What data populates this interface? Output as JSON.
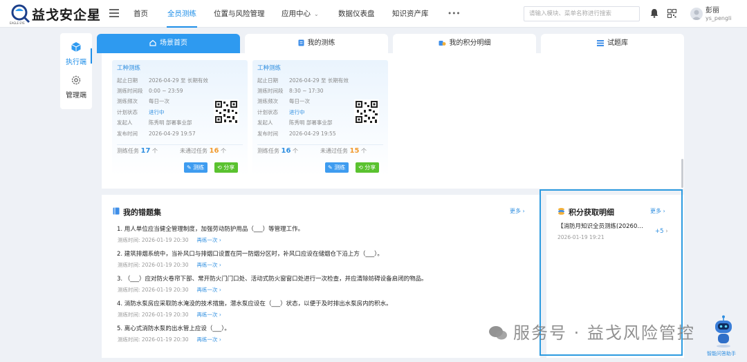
{
  "brand": {
    "name": "益戈安企星",
    "logo_caption": "EAGLE EYE"
  },
  "nav": {
    "items": [
      "首页",
      "全员测练",
      "位置与风险管理",
      "应用中心",
      "数据仪表盘",
      "知识资产库",
      "•••"
    ],
    "active": "全员测练"
  },
  "search": {
    "placeholder": "请输入模块、菜单名称进行搜索"
  },
  "user": {
    "name": "彭丽",
    "id": "ys_pengli"
  },
  "sidebar": {
    "items": [
      {
        "label": "执行端",
        "icon": "cube-icon"
      },
      {
        "label": "管理端",
        "icon": "gear-icon"
      }
    ]
  },
  "tabs": [
    {
      "label": "场景首页",
      "icon": "home-icon"
    },
    {
      "label": "我的测练",
      "icon": "document-icon"
    },
    {
      "label": "我的积分明细",
      "icon": "coins-icon"
    },
    {
      "label": "试题库",
      "icon": "list-icon"
    }
  ],
  "cards": [
    {
      "title": "工种测练",
      "rows": [
        {
          "k": "起止日期",
          "v": "2026-04-29 至 长期有效"
        },
        {
          "k": "测练时间段",
          "v": "0:00 ~ 23:59"
        },
        {
          "k": "测练频次",
          "v": "每日一次"
        },
        {
          "k": "计划状态",
          "v": "进行中"
        },
        {
          "k": "发起人",
          "v": "陈秀明  部署事业部"
        },
        {
          "k": "发布时间",
          "v": "2026-04-29 19:57"
        }
      ],
      "tasks_label": "测练任务",
      "tasks": "17",
      "unit": "个",
      "unpassed_label": "未通过任务",
      "unpassed": "16",
      "btn_test": "测练",
      "btn_share": "分享"
    },
    {
      "title": "工种测练",
      "rows": [
        {
          "k": "起止日期",
          "v": "2026-04-29 至 长期有效"
        },
        {
          "k": "测练时间段",
          "v": "8:30 ~ 17:30"
        },
        {
          "k": "测练频次",
          "v": "每日一次"
        },
        {
          "k": "计划状态",
          "v": "进行中"
        },
        {
          "k": "发起人",
          "v": "陈秀明  部署事业部"
        },
        {
          "k": "发布时间",
          "v": "2026-04-29 19:55"
        }
      ],
      "tasks_label": "测练任务",
      "tasks": "16",
      "unit": "个",
      "unpassed_label": "未通过任务",
      "unpassed": "15",
      "btn_test": "测练",
      "btn_share": "分享"
    }
  ],
  "wrong": {
    "title": "我的错题集",
    "more": "更多",
    "time_label": "测练时间:",
    "retry": "再练一次",
    "items": [
      {
        "q": "1. 用人单位应当健全管理制度，加强劳动防护用品（___）等管理工作。",
        "time": "2026-01-19 20:30"
      },
      {
        "q": "2. 建筑排烟系统中，当补风口与排烟口设置在同一防烟分区时，补风口应设在储烟仓下沿上方（___）。",
        "time": "2026-01-19 20:30"
      },
      {
        "q": "3. （___）应对防火卷帘下部、常开防火门门口处、活动式防火窗窗口处进行一次检查，并应清除妨碍设备启闭的物品。",
        "time": "2026-01-19 20:30"
      },
      {
        "q": "4. 消防水泵房应采取防水淹没的技术措施，潜水泵应设在（___）状态，以便于及时排出水泵房内的积水。",
        "time": "2026-01-19 20:30"
      },
      {
        "q": "5. 离心式消防水泵的出水管上应设（___）。",
        "time": "2026-01-19 20:30"
      }
    ]
  },
  "points": {
    "title": "积分获取明细",
    "more": "更多",
    "item": "【消防月知识全员测练(20260…",
    "plus": "+5",
    "time": "2026-01-19 19:21"
  },
  "watermark": "服务号 · 益戈风险管控",
  "assistant": {
    "label": "智能问答助手"
  },
  "colors": {
    "accent": "#1e8ee8",
    "orange": "#f29a2e",
    "green": "#5ac22f",
    "highlight": "#2b9ae0"
  }
}
